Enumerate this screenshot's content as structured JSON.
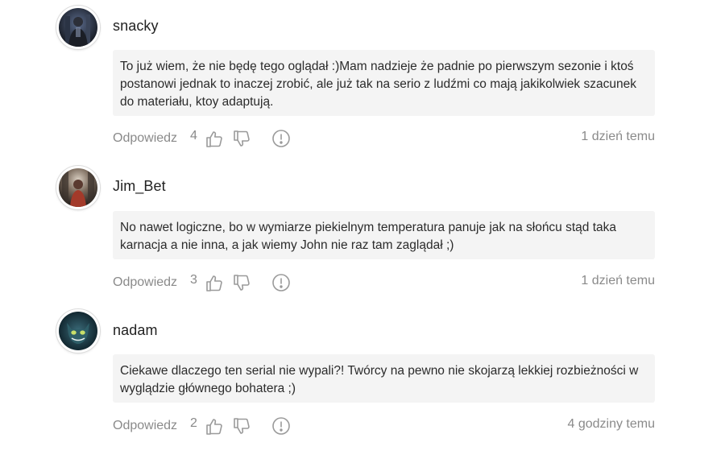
{
  "comments": [
    {
      "username": "snacky",
      "avatar_icon": "user-avatar-dark-figure",
      "text": "To już wiem, że nie będę tego oglądał :)Mam nadzieje że padnie po pierwszym sezonie i ktoś postanowi jednak to inaczej zrobić, ale już tak na serio z ludźmi co mają jakikolwiek szacunek do materiału, ktoy adaptują.",
      "reply_label": "Odpowiedz",
      "likes": "4",
      "time": "1 dzień temu"
    },
    {
      "username": "Jim_Bet",
      "avatar_icon": "user-avatar-figure-in-corridor",
      "text": "No nawet logiczne, bo w wymiarze piekielnym temperatura panuje jak na słońcu stąd taka karnacja a nie inna, a jak wiemy John nie raz tam zaglądał ;)",
      "reply_label": "Odpowiedz",
      "likes": "3",
      "time": "1 dzień temu"
    },
    {
      "username": "nadam",
      "avatar_icon": "user-avatar-cheshire-cat",
      "text": "Ciekawe dlaczego ten serial nie wypali?! Twórcy na pewno nie skojarzą lekkiej rozbieżności w wyglądzie głównego bohatera ;)",
      "reply_label": "Odpowiedz",
      "likes": "2",
      "time": "4 godziny temu"
    }
  ],
  "icons": {
    "like": "thumbs-up-icon",
    "dislike": "thumbs-down-icon",
    "report": "exclamation-circle-icon"
  },
  "colors": {
    "bubble_bg": "#f4f4f4",
    "muted_text": "#8a8a8a",
    "icon": "#9a9a9a"
  }
}
